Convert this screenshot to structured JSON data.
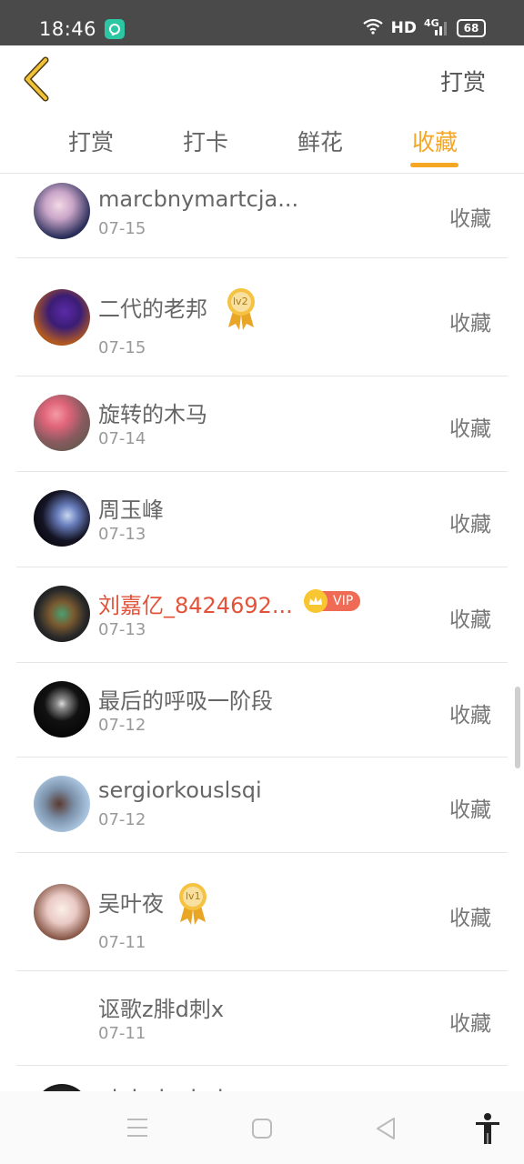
{
  "status_bar": {
    "time": "18:46",
    "network": "HD",
    "signal_label": "4G",
    "battery": "68"
  },
  "header": {
    "action_label": "打赏"
  },
  "tabs": [
    {
      "label": "打赏",
      "active": false
    },
    {
      "label": "打卡",
      "active": false
    },
    {
      "label": "鲜花",
      "active": false
    },
    {
      "label": "收藏",
      "active": true
    }
  ],
  "action_label": "收藏",
  "items": [
    {
      "name": "marcbnymartcja...",
      "date": "07-15"
    },
    {
      "name": "二代的老邦",
      "date": "07-15",
      "medal": "lv2"
    },
    {
      "name": "旋转的木马",
      "date": "07-14"
    },
    {
      "name": "周玉峰",
      "date": "07-13"
    },
    {
      "name": "刘嘉亿_8424692...",
      "date": "07-13",
      "vip": "VIP"
    },
    {
      "name": "最后的呼吸一阶段",
      "date": "07-12"
    },
    {
      "name": "sergiorkouslsqi",
      "date": "07-12"
    },
    {
      "name": "吴叶夜",
      "date": "07-11",
      "medal": "lv1"
    },
    {
      "name": "讴歌z腓d刺x",
      "date": "07-11"
    },
    {
      "name": "alpbobwivdrpov",
      "date": ""
    }
  ],
  "colors": {
    "accent": "#f5a623",
    "vip_name": "#e2533a",
    "statusbar": "#4a4a4a"
  }
}
